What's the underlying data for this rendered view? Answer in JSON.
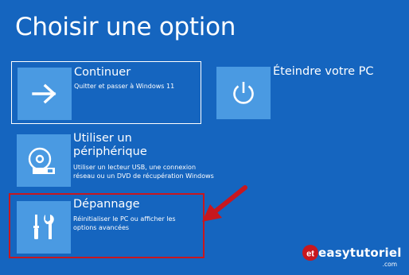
{
  "page": {
    "title": "Choisir une option"
  },
  "options": {
    "continue": {
      "label": "Continuer",
      "description": "Quitter et passer à Windows 11",
      "icon": "arrow-right-icon"
    },
    "shutdown": {
      "label": "Éteindre votre PC",
      "icon": "power-icon"
    },
    "use_device": {
      "label": "Utiliser un périphérique",
      "description": "Utiliser un lecteur USB, une connexion réseau ou un DVD de récupération Windows",
      "icon": "disc-drive-icon"
    },
    "troubleshoot": {
      "label": "Dépannage",
      "description": "Réinitialiser le PC ou afficher les options avancées",
      "icon": "tools-icon"
    }
  },
  "annotation": {
    "highlight_color": "#c8171e"
  },
  "watermark": {
    "text": "easytutoriel",
    "suffix": ".com",
    "logo": "et"
  },
  "colors": {
    "background": "#1565bf",
    "tile": "#4a9ae2",
    "text": "#ffffff"
  }
}
